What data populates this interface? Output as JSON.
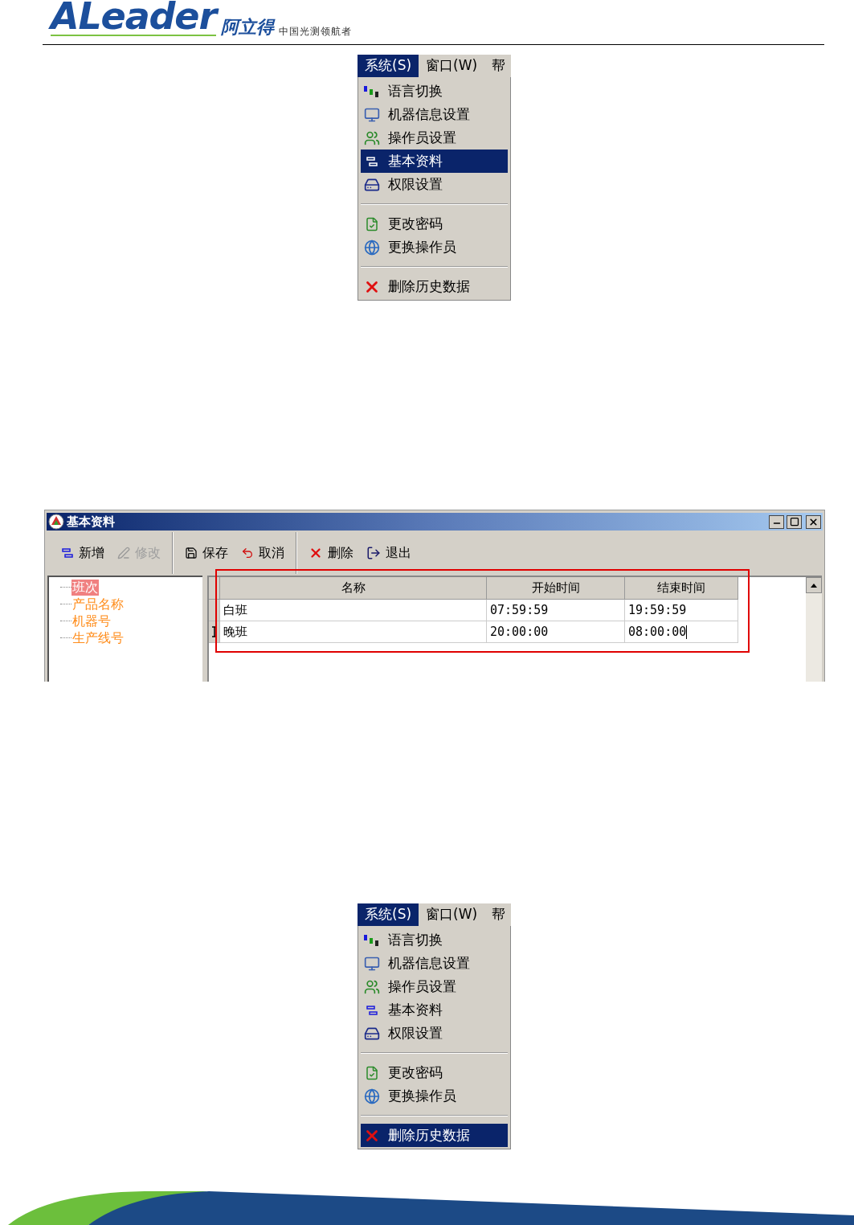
{
  "header": {
    "logo_text": "ALeader",
    "logo_cn": "阿立得",
    "slogan": "中国光测领航者"
  },
  "menus": [
    {
      "menubar": [
        {
          "label": "系统(S)",
          "selected": true
        },
        {
          "label": "窗口(W)",
          "selected": false
        },
        {
          "label": "帮",
          "selected": false
        }
      ],
      "items": [
        {
          "kind": "item",
          "label": "语言切换",
          "selected": false
        },
        {
          "kind": "item",
          "label": "机器信息设置",
          "selected": false
        },
        {
          "kind": "item",
          "label": "操作员设置",
          "selected": false
        },
        {
          "kind": "item",
          "label": "基本资料",
          "selected": true
        },
        {
          "kind": "item",
          "label": "权限设置",
          "selected": false
        },
        {
          "kind": "separator"
        },
        {
          "kind": "item",
          "label": "更改密码",
          "selected": false
        },
        {
          "kind": "item",
          "label": "更换操作员",
          "selected": false
        },
        {
          "kind": "separator"
        },
        {
          "kind": "item",
          "label": "删除历史数据",
          "selected": false
        }
      ]
    },
    {
      "menubar": [
        {
          "label": "系统(S)",
          "selected": true
        },
        {
          "label": "窗口(W)",
          "selected": false
        },
        {
          "label": "帮",
          "selected": false
        }
      ],
      "items": [
        {
          "kind": "item",
          "label": "语言切换",
          "selected": false
        },
        {
          "kind": "item",
          "label": "机器信息设置",
          "selected": false
        },
        {
          "kind": "item",
          "label": "操作员设置",
          "selected": false
        },
        {
          "kind": "item",
          "label": "基本资料",
          "selected": false
        },
        {
          "kind": "item",
          "label": "权限设置",
          "selected": false
        },
        {
          "kind": "separator"
        },
        {
          "kind": "item",
          "label": "更改密码",
          "selected": false
        },
        {
          "kind": "item",
          "label": "更换操作员",
          "selected": false
        },
        {
          "kind": "separator"
        },
        {
          "kind": "item",
          "label": "删除历史数据",
          "selected": true
        }
      ]
    }
  ],
  "window": {
    "title": "基本资料",
    "toolbar": [
      {
        "kind": "button",
        "label": "新增",
        "disabled": false
      },
      {
        "kind": "button",
        "label": "修改",
        "disabled": true
      },
      {
        "kind": "separator"
      },
      {
        "kind": "button",
        "label": "保存",
        "disabled": false
      },
      {
        "kind": "button",
        "label": "取消",
        "disabled": false
      },
      {
        "kind": "separator"
      },
      {
        "kind": "button",
        "label": "删除",
        "disabled": false
      },
      {
        "kind": "button",
        "label": "退出",
        "disabled": false
      }
    ],
    "tree": [
      {
        "label": "班次",
        "selected": true
      },
      {
        "label": "产品名称",
        "selected": false
      },
      {
        "label": "机器号",
        "selected": false
      },
      {
        "label": "生产线号",
        "selected": false
      }
    ],
    "table": {
      "columns": [
        "名称",
        "开始时间",
        "结束时间"
      ],
      "rows": [
        {
          "cells": [
            "白班",
            "07:59:59",
            "19:59:59"
          ],
          "editing": false
        },
        {
          "cells": [
            "晚班",
            "20:00:00",
            "08:00:00"
          ],
          "editing": true
        }
      ]
    }
  }
}
